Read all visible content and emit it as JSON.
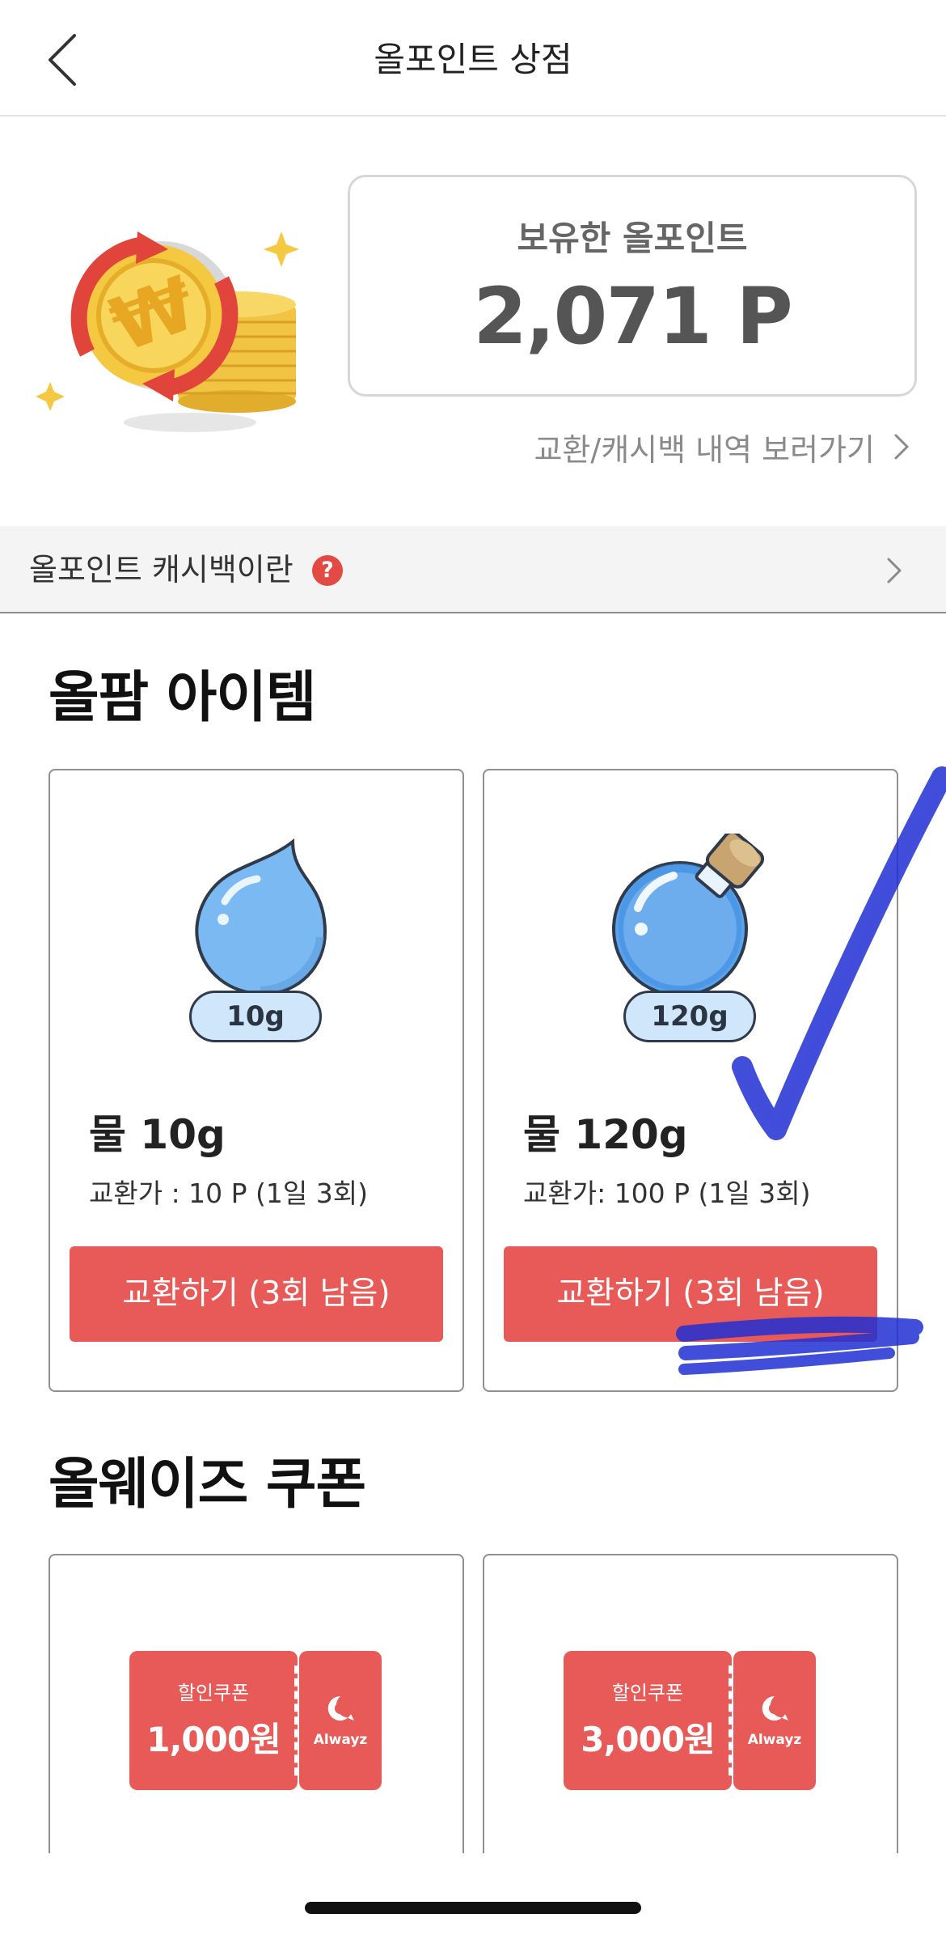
{
  "header": {
    "title": "올포인트 상점"
  },
  "points": {
    "label": "보유한 올포인트",
    "value": "2,071 P",
    "history_link": "교환/캐시백 내역 보러가기"
  },
  "info_banner": {
    "text": "올포인트 캐시백이란",
    "help_glyph": "?"
  },
  "sections": {
    "items_title": "올팜 아이템",
    "coupons_title": "올웨이즈 쿠폰"
  },
  "items": [
    {
      "badge": "10g",
      "name": "물 10g",
      "price": "교환가 : 10 P (1일 3회)",
      "button": "교환하기 (3회 남음)",
      "icon": "water-drop-icon"
    },
    {
      "badge": "120g",
      "name": "물 120g",
      "price": "교환가: 100 P (1일 3회)",
      "button": "교환하기 (3회 남음)",
      "icon": "water-bottle-icon"
    }
  ],
  "coupons": [
    {
      "label": "할인쿠폰",
      "amount": "1,000원",
      "brand": "Alwayz"
    },
    {
      "label": "할인쿠폰",
      "amount": "3,000원",
      "brand": "Alwayz"
    }
  ],
  "colors": {
    "accent_red": "#e85a57",
    "help_red": "#e24a43",
    "badge_blue": "#cfe6fb",
    "scribble_blue": "#1f2fd4"
  }
}
